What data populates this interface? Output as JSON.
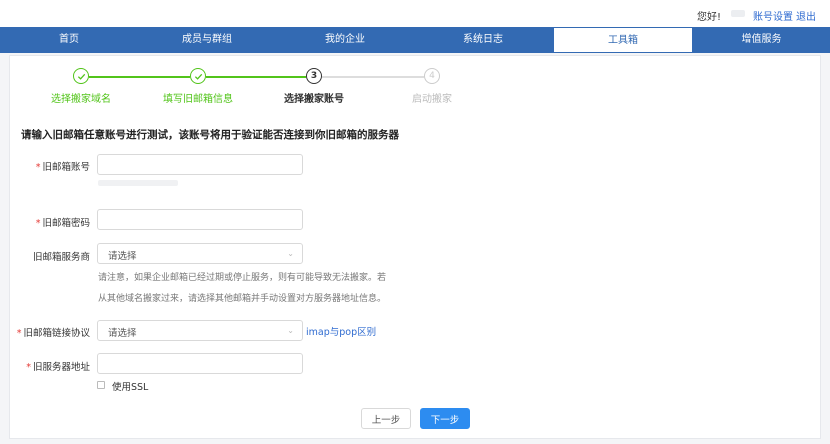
{
  "header": {
    "greeting": "您好!",
    "account_settings": "账号设置",
    "logout": "退出"
  },
  "nav": {
    "items": [
      {
        "label": "首页"
      },
      {
        "label": "成员与群组"
      },
      {
        "label": "我的企业"
      },
      {
        "label": "系统日志"
      },
      {
        "label": "工具箱",
        "active": true
      },
      {
        "label": "增值服务"
      }
    ]
  },
  "steps": [
    {
      "num": "1",
      "label": "选择搬家域名",
      "status": "done"
    },
    {
      "num": "2",
      "label": "填写旧邮箱信息",
      "status": "done"
    },
    {
      "num": "3",
      "label": "选择搬家账号",
      "status": "current"
    },
    {
      "num": "4",
      "label": "启动搬家",
      "status": "todo"
    }
  ],
  "instruction": "请输入旧邮箱任意账号进行测试，该账号将用于验证能否连接到你旧邮箱的服务器",
  "form": {
    "required_mark": "*",
    "old_account_label": "旧邮箱账号",
    "old_password_label": "旧邮箱密码",
    "provider_label": "旧邮箱服务商",
    "provider_placeholder": "请选择",
    "provider_hint_1": "请注意，如果企业邮箱已经过期或停止服务，则有可能导致无法搬家。若",
    "provider_hint_2": "从其他域名搬家过来，请选择其他邮箱并手动设置对方服务器地址信息。",
    "protocol_label": "旧邮箱链接协议",
    "protocol_placeholder": "请选择",
    "protocol_link": "imap与pop区别",
    "server_label": "旧服务器地址",
    "ssl_label": "使用SSL"
  },
  "buttons": {
    "prev": "上一步",
    "next": "下一步"
  },
  "colors": {
    "nav_bg": "#336ab3",
    "done": "#52c41a",
    "primary": "#2d8cf0",
    "link": "#2f6bd0",
    "required": "#e53935"
  }
}
